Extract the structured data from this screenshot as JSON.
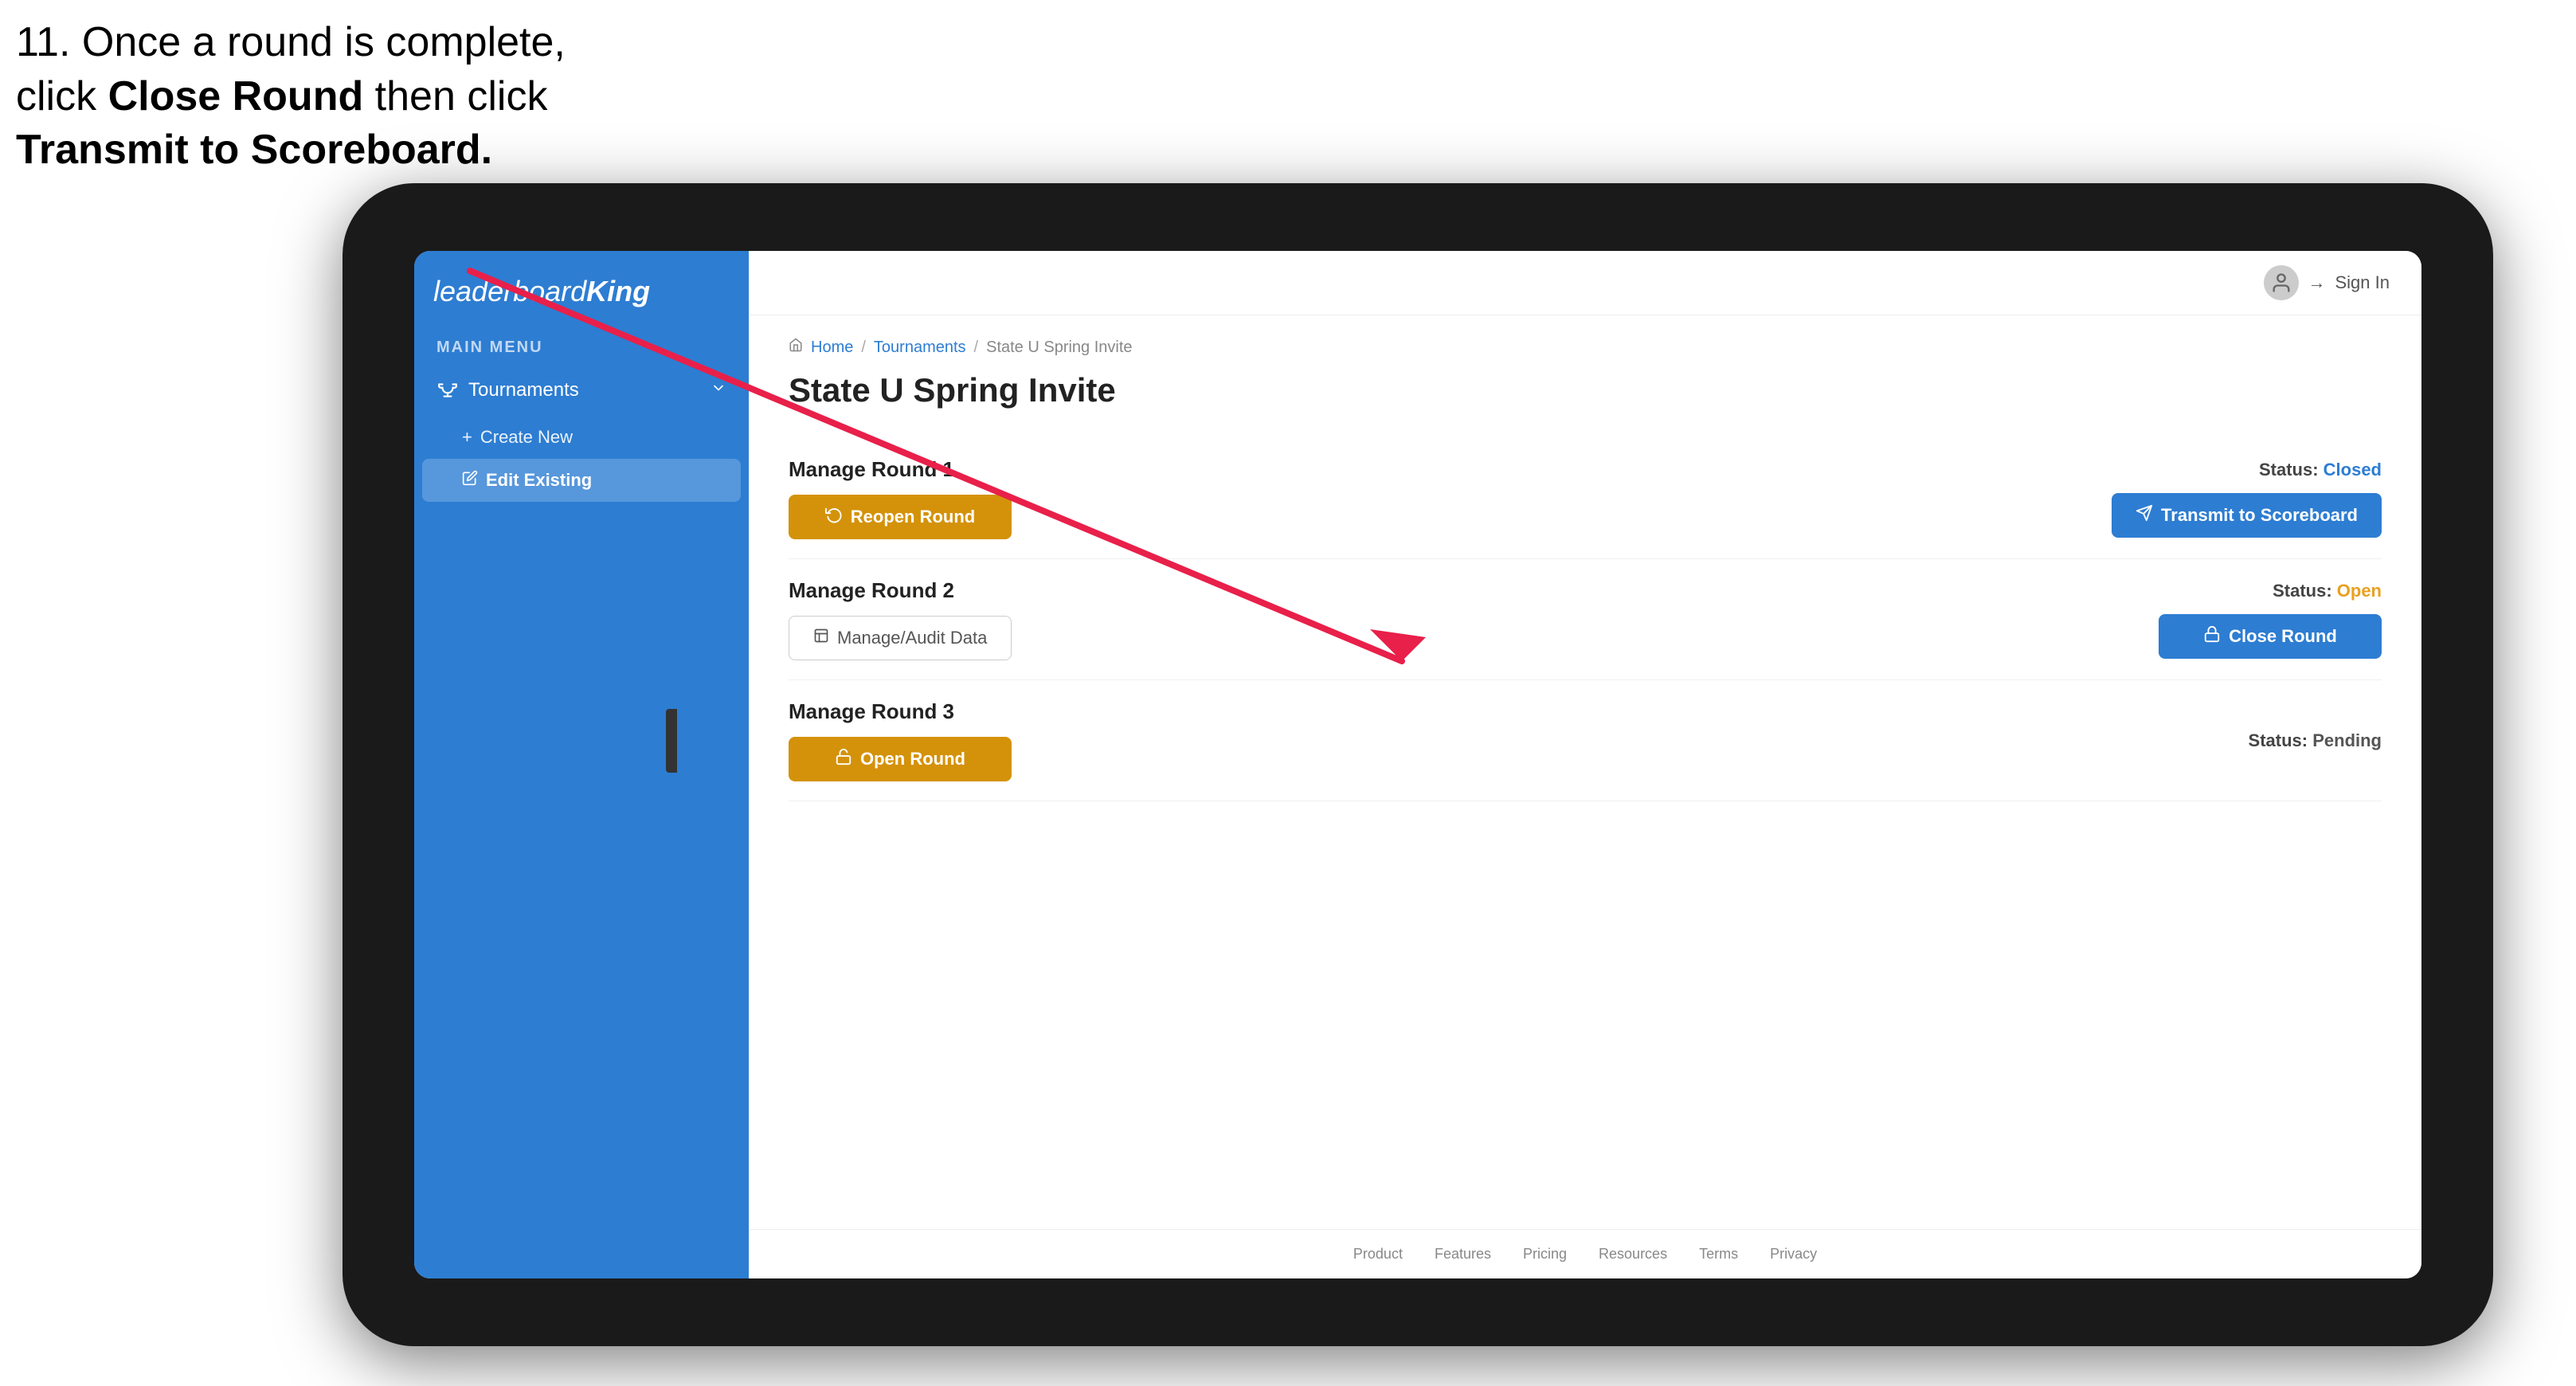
{
  "instruction": {
    "line1": "11. Once a round is complete,",
    "line2": "click ",
    "bold1": "Close Round",
    "line3": " then click",
    "bold2": "Transmit to Scoreboard."
  },
  "app": {
    "logo": "leaderboardKing",
    "logo_leader": "leaderboard",
    "logo_king": "King"
  },
  "nav": {
    "main_menu_label": "MAIN MENU",
    "tournaments_label": "Tournaments",
    "create_new_label": "Create New",
    "edit_existing_label": "Edit Existing"
  },
  "topbar": {
    "sign_in_label": "Sign In"
  },
  "breadcrumb": {
    "home": "Home",
    "tournaments": "Tournaments",
    "current": "State U Spring Invite"
  },
  "page": {
    "title": "State U Spring Invite",
    "rounds": [
      {
        "id": "round1",
        "title": "Manage Round 1",
        "status_label": "Status:",
        "status_value": "Closed",
        "status_class": "status-closed",
        "primary_btn_label": "Reopen Round",
        "primary_btn_icon": "reopen-icon",
        "secondary_btn_label": "Transmit to Scoreboard",
        "secondary_btn_icon": "transmit-icon"
      },
      {
        "id": "round2",
        "title": "Manage Round 2",
        "status_label": "Status:",
        "status_value": "Open",
        "status_class": "status-open",
        "primary_btn_label": "Manage/Audit Data",
        "primary_btn_icon": "audit-icon",
        "secondary_btn_label": "Close Round",
        "secondary_btn_icon": "close-round-icon"
      },
      {
        "id": "round3",
        "title": "Manage Round 3",
        "status_label": "Status:",
        "status_value": "Pending",
        "status_class": "status-pending",
        "primary_btn_label": "Open Round",
        "primary_btn_icon": "open-round-icon",
        "secondary_btn_label": null
      }
    ]
  },
  "footer": {
    "links": [
      "Product",
      "Features",
      "Pricing",
      "Resources",
      "Terms",
      "Privacy"
    ]
  }
}
